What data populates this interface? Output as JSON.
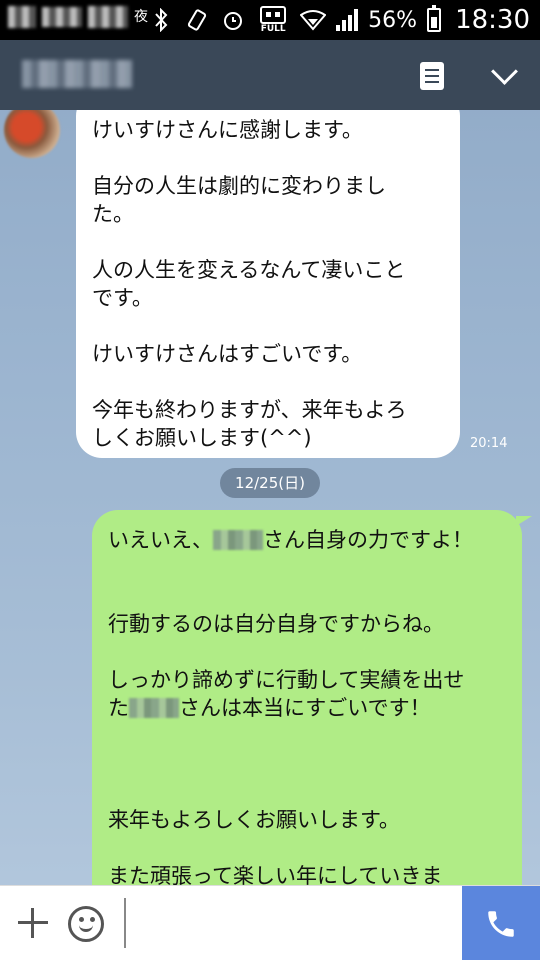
{
  "status_bar": {
    "night_label": "夜",
    "full_label": "FULL",
    "battery_percent": "56%",
    "time": "18:30"
  },
  "header": {
    "notes_icon": "notes-icon",
    "collapse_icon": "chevron-down-icon"
  },
  "messages": [
    {
      "direction": "incoming",
      "lines": [
        "けいすけさんに感謝します。",
        "",
        "自分の人生は劇的に変わりまし",
        "た。",
        "",
        "人の人生を変えるなんて凄いこと",
        "です。",
        "",
        "けいすけさんはすごいです。",
        "",
        "今年も終わりますが、来年もよろ",
        "しくお願いします(^^)"
      ],
      "time": "20:14"
    }
  ],
  "date_separator": "12/25(日)",
  "outgoing": {
    "line1_before": "いえいえ、",
    "line1_after": "さん自身の力ですよ！",
    "line2": "行動するのは自分自身ですからね。",
    "line3": "しっかり諦めずに行動して実績を出せ",
    "line4_before": "た",
    "line4_after": "さんは本当にすごいです！",
    "line5": "来年もよろしくお願いします。",
    "line6": "また頑張って楽しい年にしていきま"
  },
  "colors": {
    "header_bg": "#3a4858",
    "outgoing_bubble": "#b0ec86",
    "incoming_bubble": "#ffffff",
    "call_button": "#5b86dd"
  }
}
